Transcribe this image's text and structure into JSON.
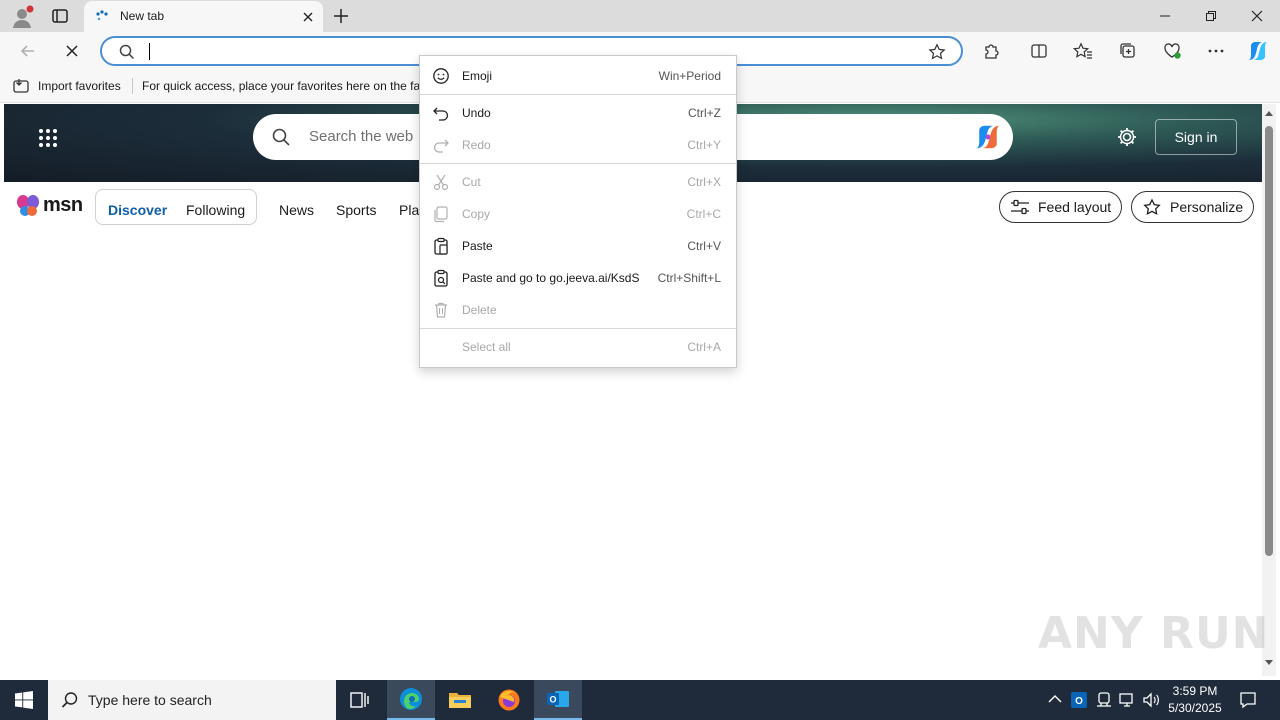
{
  "tabs": [
    {
      "title": "New tab"
    }
  ],
  "toolbar": {
    "address_value": ""
  },
  "favorites_bar": {
    "import_label": "Import favorites",
    "hint": "For quick access, place your favorites here on the fav"
  },
  "msn": {
    "logo": "msn",
    "search_placeholder": "Search the web",
    "sign_in": "Sign in",
    "nav_pills": [
      "Discover",
      "Following"
    ],
    "nav_links": [
      "News",
      "Sports",
      "Play"
    ],
    "feed_layout": "Feed layout",
    "personalize": "Personalize"
  },
  "context_menu": {
    "items": [
      {
        "label": "Emoji",
        "shortcut": "Win+Period",
        "icon": "emoji-icon",
        "enabled": true
      },
      {
        "label": "Undo",
        "shortcut": "Ctrl+Z",
        "icon": "undo-icon",
        "enabled": true
      },
      {
        "label": "Redo",
        "shortcut": "Ctrl+Y",
        "icon": "redo-icon",
        "enabled": false
      },
      {
        "label": "Cut",
        "shortcut": "Ctrl+X",
        "icon": "cut-icon",
        "enabled": false
      },
      {
        "label": "Copy",
        "shortcut": "Ctrl+C",
        "icon": "copy-icon",
        "enabled": false
      },
      {
        "label": "Paste",
        "shortcut": "Ctrl+V",
        "icon": "paste-icon",
        "enabled": true
      },
      {
        "label": "Paste and go to go.jeeva.ai/KsdS",
        "shortcut": "Ctrl+Shift+L",
        "icon": "paste-and-go-icon",
        "enabled": true
      },
      {
        "label": "Delete",
        "shortcut": "",
        "icon": "delete-icon",
        "enabled": false
      },
      {
        "label": "Select all",
        "shortcut": "Ctrl+A",
        "icon": "",
        "enabled": false
      }
    ]
  },
  "watermark": "ANY RUN",
  "taskbar": {
    "search_placeholder": "Type here to search",
    "time": "3:59 PM",
    "date": "5/30/2025"
  },
  "colors": {
    "accent": "#0f6cbd",
    "taskbar": "#1f2b3a",
    "address_border": "#4a8fd6"
  }
}
